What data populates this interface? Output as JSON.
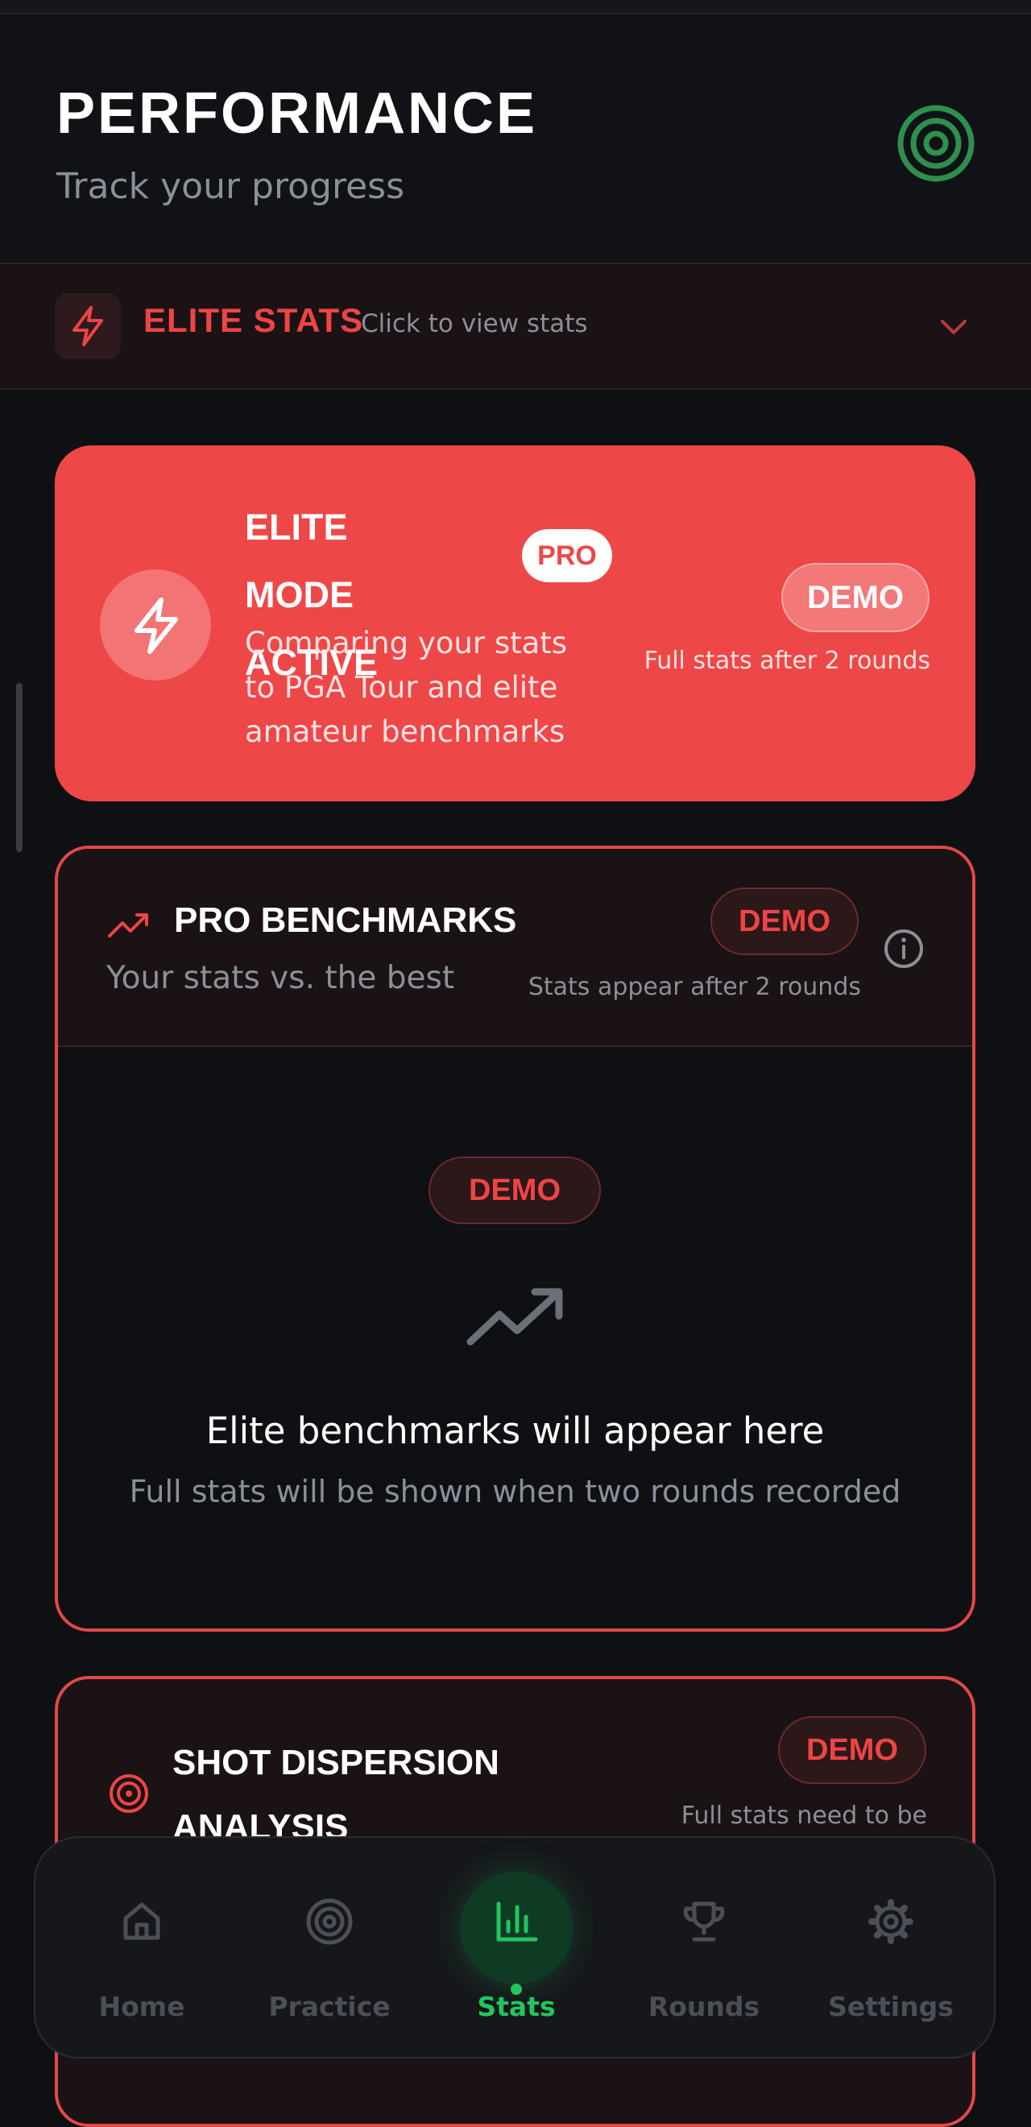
{
  "header": {
    "title": "PERFORMANCE",
    "subtitle": "Track your progress",
    "logo_icon": "target-icon"
  },
  "elite_strip": {
    "icon": "bolt-icon",
    "label": "ELITE STATS",
    "hint": "Click to view stats",
    "chevron": "chevron-down-icon"
  },
  "elite_card": {
    "icon": "bolt-icon",
    "heading_line1": "ELITE MODE",
    "heading_line2": "ACTIVE",
    "pro_badge": "PRO",
    "description": "Comparing your stats to PGA Tour and elite amateur benchmarks",
    "demo_label": "DEMO",
    "note": "Full stats after 2 rounds"
  },
  "pro_benchmarks": {
    "icon": "trending-up-icon",
    "title": "PRO BENCHMARKS",
    "subtitle": "Your stats vs. the best",
    "demo_label": "DEMO",
    "note": "Stats appear after 2 rounds",
    "info_icon": "info-icon",
    "body_demo_label": "DEMO",
    "empty_title": "Elite benchmarks will appear here",
    "empty_subtitle": "Full stats will be shown when two rounds recorded"
  },
  "shot_dispersion": {
    "icon": "target-icon",
    "title": "SHOT DISPERSION ANALYSIS",
    "demo_label": "DEMO",
    "note": "Full stats need to be"
  },
  "bottom_nav": {
    "items": [
      {
        "label": "Home",
        "icon": "home-icon"
      },
      {
        "label": "Practice",
        "icon": "target-icon"
      },
      {
        "label": "Stats",
        "icon": "bar-chart-icon",
        "active": true
      },
      {
        "label": "Rounds",
        "icon": "trophy-icon"
      },
      {
        "label": "Settings",
        "icon": "gear-icon"
      }
    ]
  },
  "colors": {
    "background": "#0f1014",
    "accent_red": "#ef4444",
    "elite_card_red": "#ee4747",
    "active_green": "#22c55e",
    "muted_text": "#8b8f99"
  }
}
